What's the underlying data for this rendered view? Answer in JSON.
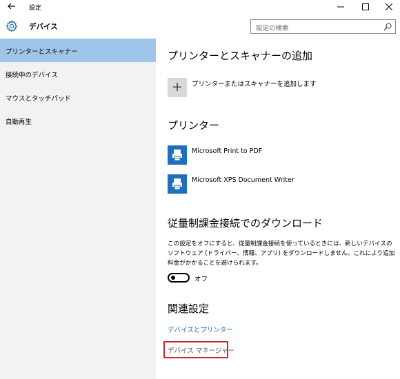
{
  "window": {
    "title": "設定",
    "section": "デバイス"
  },
  "search": {
    "placeholder": "設定の検索"
  },
  "sidebar": {
    "items": [
      {
        "label": "プリンターとスキャナー",
        "selected": true
      },
      {
        "label": "接続中のデバイス",
        "selected": false
      },
      {
        "label": "マウスとタッチパッド",
        "selected": false
      },
      {
        "label": "自動再生",
        "selected": false
      }
    ]
  },
  "main": {
    "add_heading": "プリンターとスキャナーの追加",
    "add_label": "プリンターまたはスキャナーを追加します",
    "printers_heading": "プリンター",
    "printers": [
      {
        "name": "Microsoft Print to PDF",
        "icon": "printer-icon"
      },
      {
        "name": "Microsoft XPS Document Writer",
        "icon": "printer-icon"
      }
    ],
    "metered_heading": "従量制課金接続でのダウンロード",
    "metered_description": "この設定をオフにすると、従量制課金接続を使っているときには、新しいデバイスのソフトウェア (ドライバー、情報、アプリ) をダウンロードしません。これにより追加料金がかかることを避けられます。",
    "toggle_state": "オフ",
    "related_heading": "関連設定",
    "links": [
      {
        "label": "デバイスとプリンター"
      },
      {
        "label": "デバイス マネージャー"
      }
    ]
  },
  "colors": {
    "accent": "#1f6fbd",
    "selected_bg": "#9fc6ea",
    "sidebar_bg": "#f2f2f2",
    "highlight_border": "#d0232a"
  }
}
